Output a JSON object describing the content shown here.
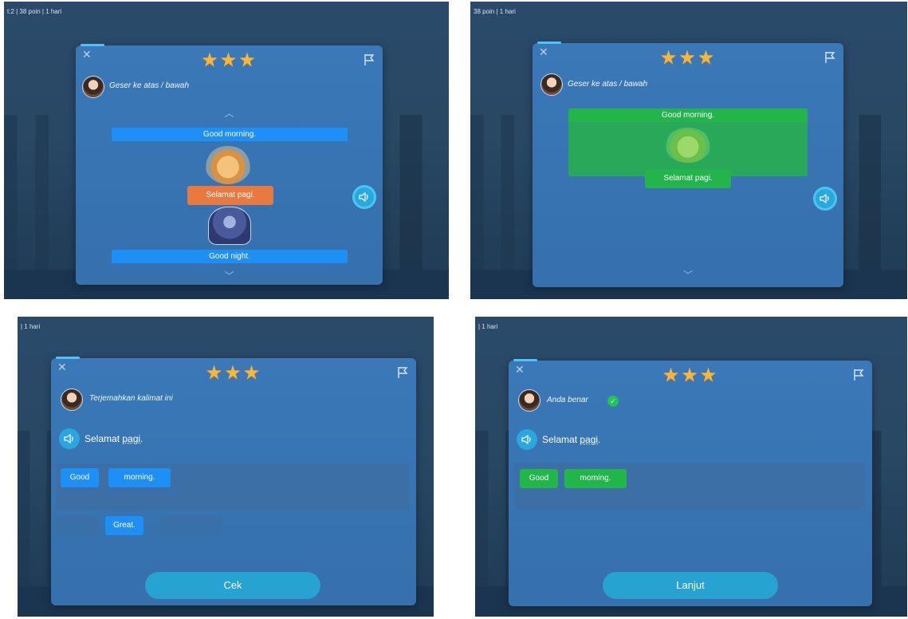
{
  "q1": {
    "topbar": "t:2 | 38 poin | 1 hari",
    "stars": "★★★",
    "instruction": "Geser ke atas / bawah",
    "option_top": "Good morning.",
    "selected_label": "Selamat pagi.",
    "option_bottom": "Good night."
  },
  "q2": {
    "topbar": "38 poin | 1 hari",
    "stars": "★★★",
    "instruction": "Geser ke atas / bawah",
    "option_top": "Good morning.",
    "selected_label": "Selamat pagi."
  },
  "q3": {
    "topbar": "| 1 hari",
    "stars": "★★★",
    "instruction": "Terjemahkan kalimat ini",
    "sentence_part1": "Selamat ",
    "sentence_part2": "pagi",
    "sentence_part3": ".",
    "answer_words": [
      "Good",
      "morning."
    ],
    "bank_word": "Great.",
    "button": "Cek"
  },
  "q4": {
    "topbar": "| 1 hari",
    "stars": "★★★",
    "instruction": "Anda benar",
    "sentence_part1": "Selamat ",
    "sentence_part2": "pagi",
    "sentence_part3": ".",
    "answer_words": [
      "Good",
      "morning."
    ],
    "button": "Lanjut"
  },
  "colors": {
    "accent_blue": "#1e8ff5",
    "selected_orange": "#e9793f",
    "correct_green": "#22b64a",
    "star_gold": "#f6b73c",
    "button_teal": "#27a3d1"
  },
  "icons": [
    "close-icon",
    "flag-icon",
    "speaker-icon",
    "chevron-up-icon",
    "chevron-down-icon",
    "check-icon"
  ]
}
